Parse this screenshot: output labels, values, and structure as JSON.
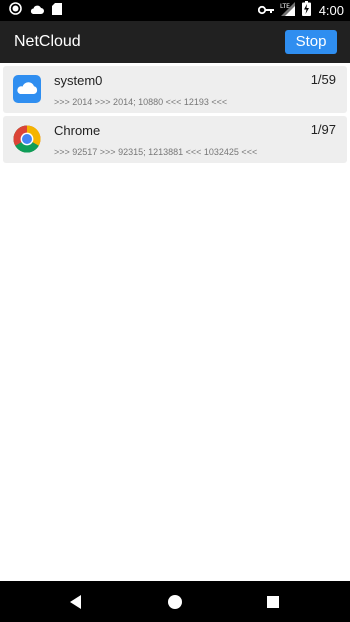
{
  "status_bar": {
    "time": "4:00",
    "icons_left": [
      "circle-notification-icon",
      "cloud-notification-icon",
      "sd-card-icon"
    ],
    "icons_right": [
      "vpn-key-icon",
      "lte-signal-icon",
      "battery-charging-icon"
    ]
  },
  "app_bar": {
    "title": "NetCloud",
    "stop_label": "Stop",
    "accent": "#2f8ef0"
  },
  "apps": [
    {
      "name": "system0",
      "icon": "cloud-app-icon",
      "count": "1/59",
      "stats": ">>> 2014 >>> 2014; 10880 <<< 12193 <<<"
    },
    {
      "name": "Chrome",
      "icon": "chrome-app-icon",
      "count": "1/97",
      "stats": ">>> 92517 >>> 92315; 1213881 <<< 1032425 <<<"
    }
  ],
  "nav_bar": {
    "icons": [
      "back-icon",
      "home-icon",
      "recents-icon"
    ]
  }
}
